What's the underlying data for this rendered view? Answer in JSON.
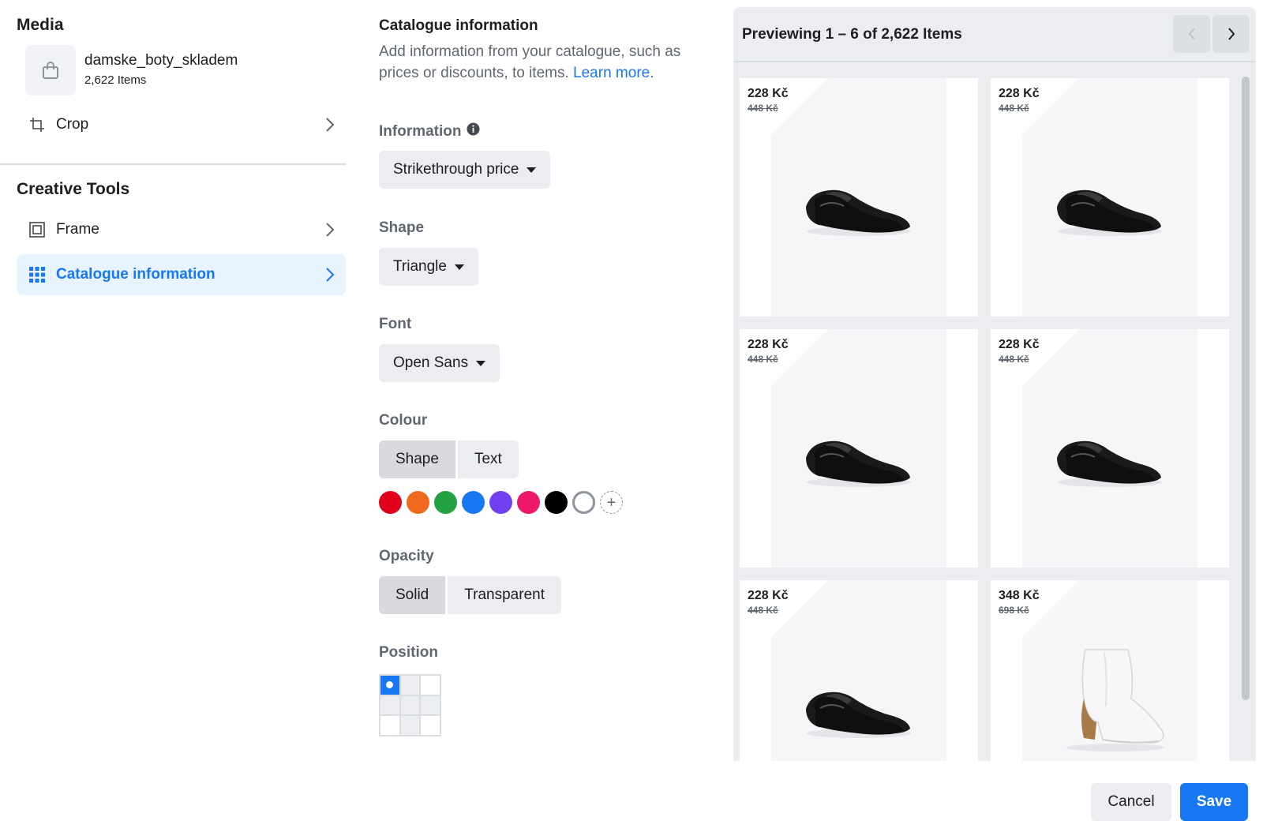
{
  "media": {
    "title": "Media",
    "catalogue_name": "damske_boty_skladem",
    "catalogue_count": "2,622 Items",
    "crop_label": "Crop"
  },
  "creative_tools": {
    "title": "Creative Tools",
    "items": [
      {
        "label": "Frame",
        "icon": "frame-icon",
        "active": false
      },
      {
        "label": "Catalogue information",
        "icon": "grid-icon",
        "active": true
      }
    ]
  },
  "catalogue_info": {
    "title": "Catalogue information",
    "description": "Add information from your catalogue, such as prices or discounts, to items.",
    "learn_more": "Learn more.",
    "information_label": "Information",
    "information_value": "Strikethrough price",
    "shape_label": "Shape",
    "shape_value": "Triangle",
    "font_label": "Font",
    "font_value": "Open Sans",
    "colour_label": "Colour",
    "colour_tabs": [
      "Shape",
      "Text"
    ],
    "colour_selected_tab": "Shape",
    "colours": [
      "#e0001b",
      "#f06a1d",
      "#24a140",
      "#1877f2",
      "#6f3ff0",
      "#ee1869",
      "#000000",
      "#ffffff"
    ],
    "opacity_label": "Opacity",
    "opacity_options": [
      "Solid",
      "Transparent"
    ],
    "opacity_selected": "Solid",
    "position_label": "Position",
    "position_selected": "top-left"
  },
  "preview": {
    "title": "Previewing 1 – 6 of 2,622 Items",
    "items": [
      {
        "price": "228 Kč",
        "old_price": "448 Kč",
        "product": "black-loafer"
      },
      {
        "price": "228 Kč",
        "old_price": "448 Kč",
        "product": "black-loafer"
      },
      {
        "price": "228 Kč",
        "old_price": "448 Kč",
        "product": "black-loafer"
      },
      {
        "price": "228 Kč",
        "old_price": "448 Kč",
        "product": "black-loafer"
      },
      {
        "price": "228 Kč",
        "old_price": "448 Kč",
        "product": "black-loafer"
      },
      {
        "price": "348 Kč",
        "old_price": "698 Kč",
        "product": "white-ankle-boot"
      }
    ]
  },
  "footer": {
    "cancel_label": "Cancel",
    "save_label": "Save"
  }
}
